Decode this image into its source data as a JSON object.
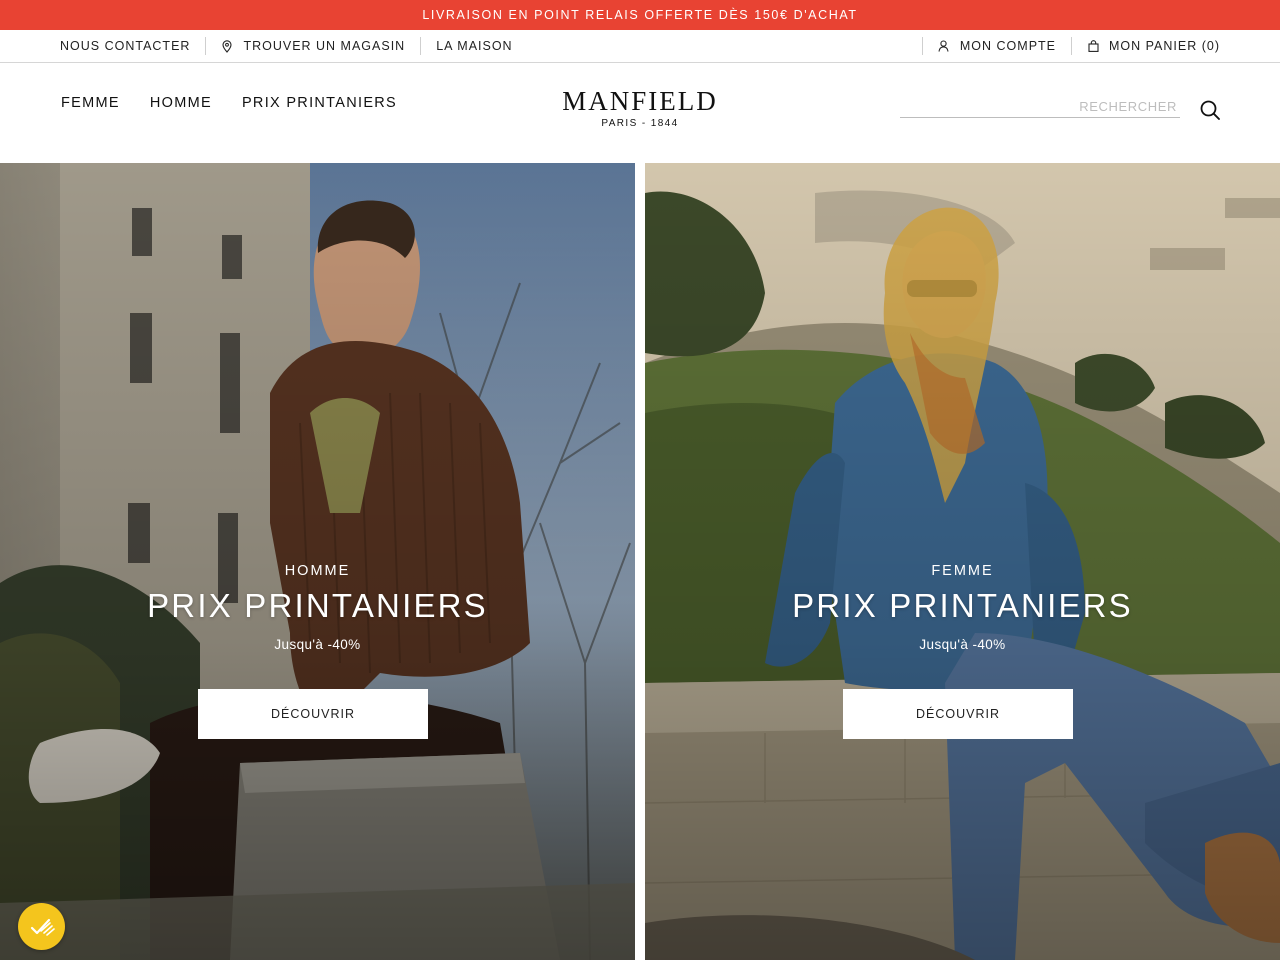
{
  "promo": {
    "text": "LIVRAISON EN POINT RELAIS OFFERTE DÈS 150€ D'ACHAT"
  },
  "utility": {
    "contact": "NOUS CONTACTER",
    "store_locator": "TROUVER UN MAGASIN",
    "maison": "LA MAISON",
    "account": "MON COMPTE",
    "cart": "MON PANIER (0)"
  },
  "nav": {
    "items": [
      {
        "label": "FEMME"
      },
      {
        "label": "HOMME"
      },
      {
        "label": "PRIX PRINTANIERS"
      }
    ]
  },
  "logo": {
    "name": "MANFIELD",
    "tagline": "PARIS - 1844"
  },
  "search": {
    "placeholder": "RECHERCHER",
    "value": ""
  },
  "hero": [
    {
      "category": "HOMME",
      "title": "PRIX PRINTANIERS",
      "subtitle": "Jusqu'à -40%",
      "cta": "DÉCOUVRIR"
    },
    {
      "category": "FEMME",
      "title": "PRIX PRINTANIERS",
      "subtitle": "Jusqu'à -40%",
      "cta": "DÉCOUVRIR"
    }
  ],
  "colors": {
    "promo_bg": "#e84333",
    "cookie_badge": "#f4c51d"
  },
  "icons": {
    "store": "map-pin-icon",
    "account": "user-icon",
    "cart": "shopping-bag-icon",
    "search": "search-icon",
    "cookie": "cookie-consent-icon"
  }
}
